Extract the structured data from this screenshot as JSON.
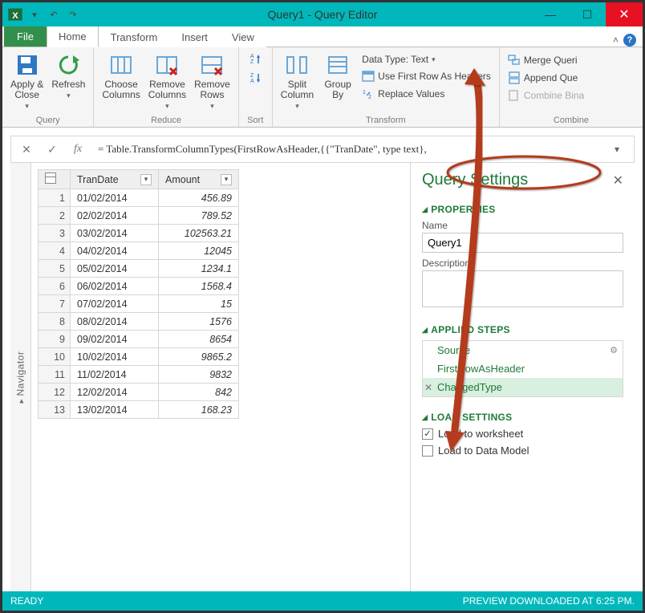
{
  "window": {
    "title": "Query1 - Query Editor"
  },
  "qat": {
    "icon": "excel",
    "undo": "↶",
    "redo": "↷"
  },
  "ribbon_tabs": {
    "file": "File",
    "home": "Home",
    "transform": "Transform",
    "insert": "Insert",
    "view": "View"
  },
  "ribbon": {
    "query": {
      "label": "Query",
      "apply_close": "Apply &\nClose",
      "refresh": "Refresh"
    },
    "reduce": {
      "label": "Reduce",
      "choose_cols": "Choose\nColumns",
      "remove_cols": "Remove\nColumns",
      "remove_rows": "Remove\nRows"
    },
    "sort": {
      "label": "Sort",
      "asc": "A→Z",
      "desc": "Z→A"
    },
    "transform": {
      "label": "Transform",
      "split": "Split\nColumn",
      "groupby": "Group\nBy",
      "data_type": "Data Type: Text",
      "first_row": "Use First Row As Headers",
      "replace": "Replace Values"
    },
    "combine": {
      "label": "Combine",
      "merge": "Merge Queri",
      "append": "Append Que",
      "combine_bin": "Combine Bina"
    }
  },
  "formula": {
    "fx": "fx",
    "text": "= Table.TransformColumnTypes(FirstRowAsHeader,{{\"TranDate\", type text},"
  },
  "navigator_label": "Navigator",
  "grid": {
    "headers": {
      "date": "TranDate",
      "amount": "Amount"
    },
    "rows": [
      {
        "n": "1",
        "date": "01/02/2014",
        "amt": "456.89"
      },
      {
        "n": "2",
        "date": "02/02/2014",
        "amt": "789.52"
      },
      {
        "n": "3",
        "date": "03/02/2014",
        "amt": "102563.21"
      },
      {
        "n": "4",
        "date": "04/02/2014",
        "amt": "12045"
      },
      {
        "n": "5",
        "date": "05/02/2014",
        "amt": "1234.1"
      },
      {
        "n": "6",
        "date": "06/02/2014",
        "amt": "1568.4"
      },
      {
        "n": "7",
        "date": "07/02/2014",
        "amt": "15"
      },
      {
        "n": "8",
        "date": "08/02/2014",
        "amt": "1576"
      },
      {
        "n": "9",
        "date": "09/02/2014",
        "amt": "8654"
      },
      {
        "n": "10",
        "date": "10/02/2014",
        "amt": "9865.2"
      },
      {
        "n": "11",
        "date": "11/02/2014",
        "amt": "9832"
      },
      {
        "n": "12",
        "date": "12/02/2014",
        "amt": "842"
      },
      {
        "n": "13",
        "date": "13/02/2014",
        "amt": "168.23"
      }
    ]
  },
  "settings": {
    "title": "Query Settings",
    "properties_header": "PROPERTIES",
    "name_label": "Name",
    "name_value": "Query1",
    "desc_label": "Description",
    "desc_value": "",
    "steps_header": "APPLIED STEPS",
    "steps": [
      {
        "label": "Source",
        "gear": true,
        "del": false,
        "sel": false
      },
      {
        "label": "FirstRowAsHeader",
        "gear": false,
        "del": false,
        "sel": false
      },
      {
        "label": "ChangedType",
        "gear": false,
        "del": true,
        "sel": true
      }
    ],
    "load_header": "LOAD SETTINGS",
    "load_ws": "Load to worksheet",
    "load_dm": "Load to Data Model",
    "load_ws_checked": true,
    "load_dm_checked": false
  },
  "status": {
    "left": "READY",
    "right": "PREVIEW DOWNLOADED AT 6:25 PM."
  }
}
